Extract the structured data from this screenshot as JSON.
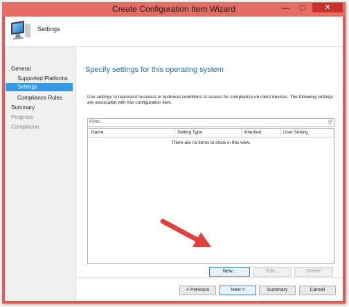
{
  "window": {
    "title": "Create Configuration Item Wizard",
    "controls": {
      "minimize": "—",
      "maximize": "□",
      "close": "✕"
    },
    "accent_color": "#e46c62"
  },
  "header": {
    "page_title": "Settings",
    "icon": "computer-monitor-icon"
  },
  "nav": {
    "items": [
      {
        "label": "General",
        "state": "normal"
      },
      {
        "label": "Supported Platforms",
        "state": "normal"
      },
      {
        "label": "Settings",
        "state": "selected"
      },
      {
        "label": "Compliance Rules",
        "state": "normal"
      },
      {
        "label": "Summary",
        "state": "normal"
      },
      {
        "label": "Progress",
        "state": "disabled"
      },
      {
        "label": "Completion",
        "state": "disabled"
      }
    ]
  },
  "main": {
    "heading": "Specify settings for this operating system",
    "description": "Use settings to represent business or technical conditions to assess for compliance on client devices. The following settings are associated with this configuration item.",
    "filter": {
      "placeholder": "Filter...",
      "icon": "search-icon"
    },
    "table": {
      "columns": [
        "Name",
        "Setting Type",
        "Inherited",
        "User Setting"
      ],
      "empty_message": "There are no items to show in this view."
    },
    "row_buttons": {
      "new": "New...",
      "edit": "Edit...",
      "delete": "Delete"
    }
  },
  "footer": {
    "previous": "< Previous",
    "next": "Next >",
    "summary": "Summary",
    "cancel": "Cancel"
  },
  "annotation": {
    "arrow_color": "#e0413a"
  }
}
